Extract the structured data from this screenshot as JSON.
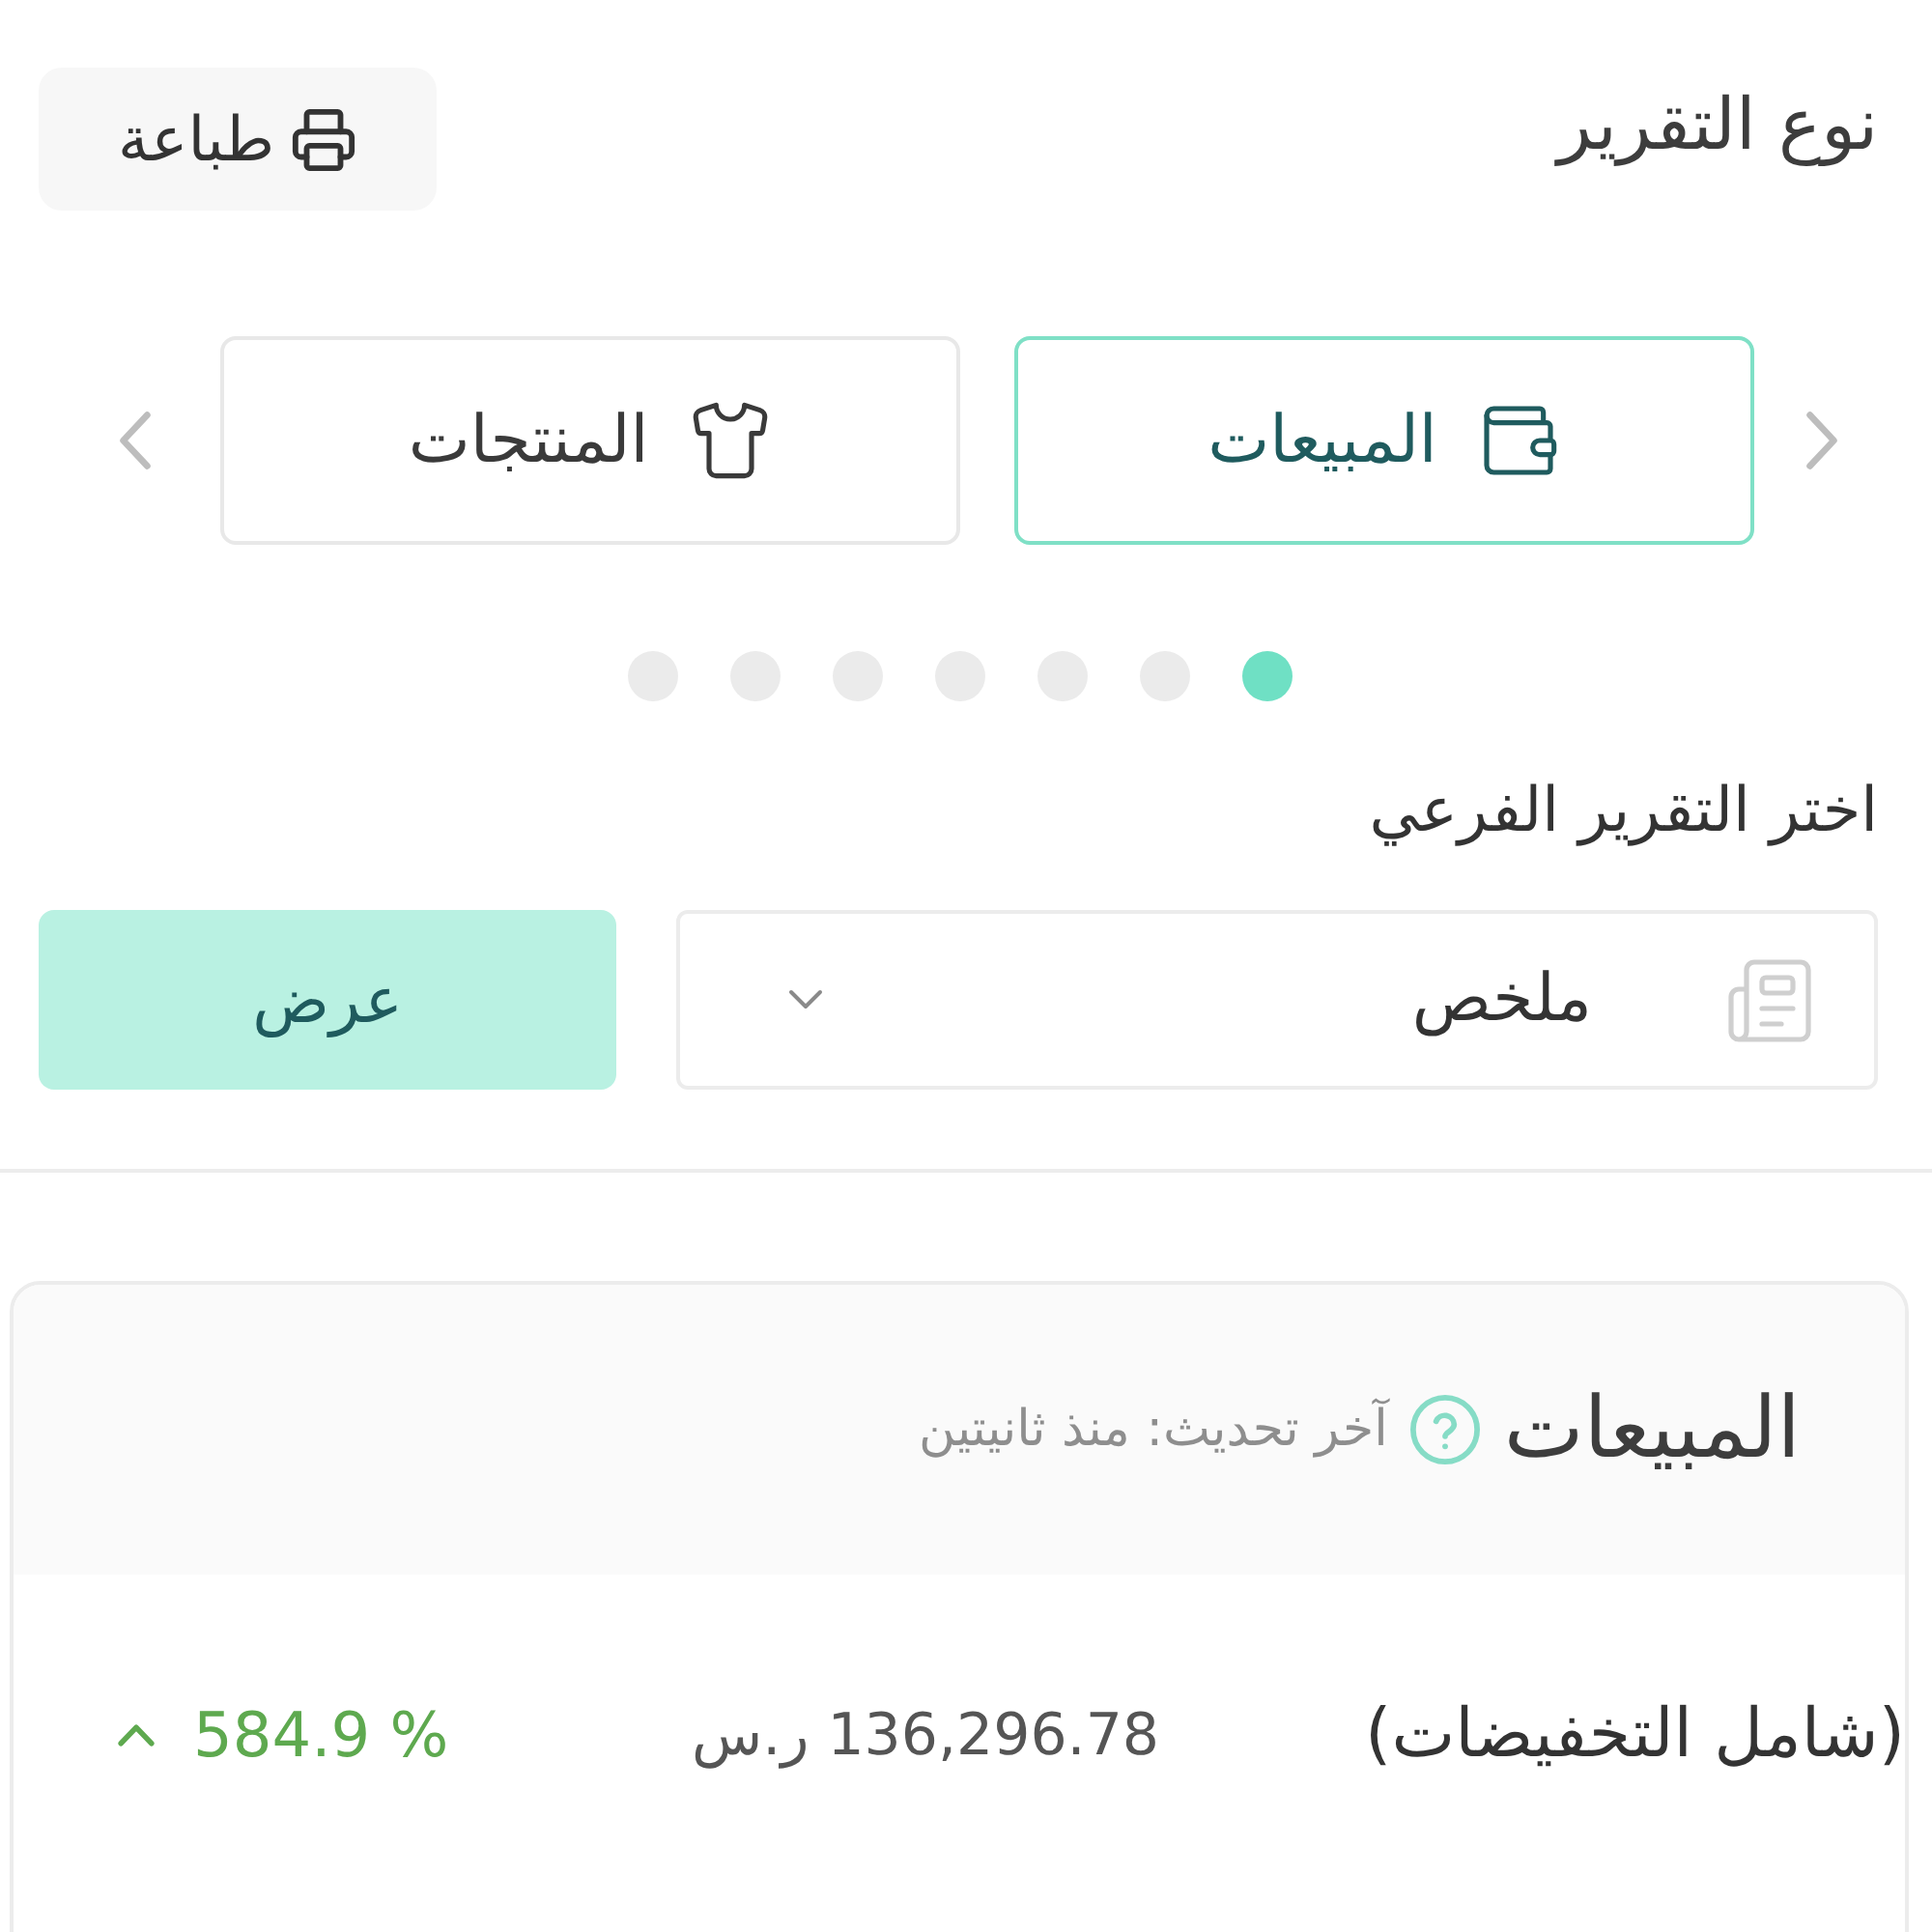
{
  "header": {
    "title": "نوع التقرير",
    "print_button": "طباعة"
  },
  "report_types": [
    {
      "label": "المبيعات",
      "selected": true
    },
    {
      "label": "المنتجات",
      "selected": false
    }
  ],
  "pager": {
    "dots": [
      {
        "selected": true
      },
      {
        "selected": false
      },
      {
        "selected": false
      },
      {
        "selected": false
      },
      {
        "selected": false
      },
      {
        "selected": false
      },
      {
        "selected": false
      }
    ]
  },
  "subreport": {
    "label": "اختر التقرير الفرعي",
    "value": "ملخص",
    "button": "عرض"
  },
  "summary": {
    "title": "المبيعات",
    "updated": "آخر تحديث: منذ ثانيتين",
    "rows": [
      {
        "label": "(شامل التخفيضات)",
        "amount": "136,296.78 ر.س",
        "change": "584.9 %",
        "rising": true
      }
    ]
  }
}
